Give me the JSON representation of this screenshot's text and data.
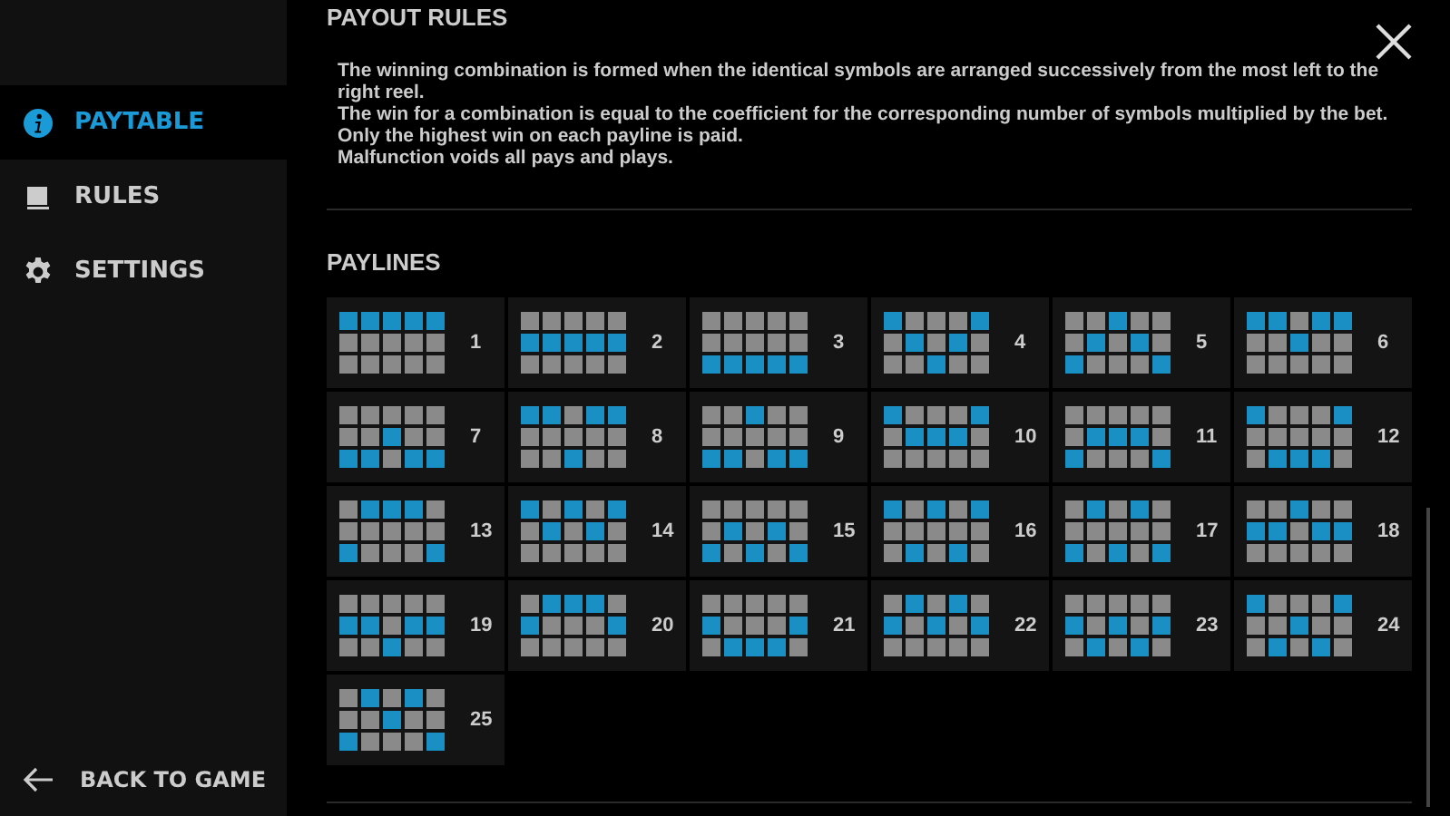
{
  "sidebar": {
    "items": [
      {
        "label": "PAYTABLE",
        "kind": "info",
        "selected": true
      },
      {
        "label": "RULES",
        "kind": "book",
        "selected": false
      },
      {
        "label": "SETTINGS",
        "kind": "gear",
        "selected": false
      }
    ],
    "back": {
      "label": "BACK TO GAME"
    }
  },
  "payout_rules": {
    "title": "PAYOUT RULES",
    "lines": [
      "The winning combination is formed when the identical symbols are arranged successively from the most left to the right reel.",
      "The win for a combination is equal to the coefficient for the corresponding number of symbols multiplied by the bet.",
      "Only the highest win on each payline is paid.",
      "Malfunction voids all pays and plays."
    ]
  },
  "paylines": {
    "title": "PAYLINES",
    "items": [
      {
        "number": "1",
        "cells": [
          [
            true,
            true,
            true,
            true,
            true
          ],
          [
            false,
            false,
            false,
            false,
            false
          ],
          [
            false,
            false,
            false,
            false,
            false
          ]
        ]
      },
      {
        "number": "2",
        "cells": [
          [
            false,
            false,
            false,
            false,
            false
          ],
          [
            true,
            true,
            true,
            true,
            true
          ],
          [
            false,
            false,
            false,
            false,
            false
          ]
        ]
      },
      {
        "number": "3",
        "cells": [
          [
            false,
            false,
            false,
            false,
            false
          ],
          [
            false,
            false,
            false,
            false,
            false
          ],
          [
            true,
            true,
            true,
            true,
            true
          ]
        ]
      },
      {
        "number": "4",
        "cells": [
          [
            true,
            false,
            false,
            false,
            true
          ],
          [
            false,
            true,
            false,
            true,
            false
          ],
          [
            false,
            false,
            true,
            false,
            false
          ]
        ]
      },
      {
        "number": "5",
        "cells": [
          [
            false,
            false,
            true,
            false,
            false
          ],
          [
            false,
            true,
            false,
            true,
            false
          ],
          [
            true,
            false,
            false,
            false,
            true
          ]
        ]
      },
      {
        "number": "6",
        "cells": [
          [
            true,
            true,
            false,
            true,
            true
          ],
          [
            false,
            false,
            true,
            false,
            false
          ],
          [
            false,
            false,
            false,
            false,
            false
          ]
        ]
      },
      {
        "number": "7",
        "cells": [
          [
            false,
            false,
            false,
            false,
            false
          ],
          [
            false,
            false,
            true,
            false,
            false
          ],
          [
            true,
            true,
            false,
            true,
            true
          ]
        ]
      },
      {
        "number": "8",
        "cells": [
          [
            true,
            true,
            false,
            true,
            true
          ],
          [
            false,
            false,
            false,
            false,
            false
          ],
          [
            false,
            false,
            true,
            false,
            false
          ]
        ]
      },
      {
        "number": "9",
        "cells": [
          [
            false,
            false,
            true,
            false,
            false
          ],
          [
            false,
            false,
            false,
            false,
            false
          ],
          [
            true,
            true,
            false,
            true,
            true
          ]
        ]
      },
      {
        "number": "10",
        "cells": [
          [
            true,
            false,
            false,
            false,
            true
          ],
          [
            false,
            true,
            true,
            true,
            false
          ],
          [
            false,
            false,
            false,
            false,
            false
          ]
        ]
      },
      {
        "number": "11",
        "cells": [
          [
            false,
            false,
            false,
            false,
            false
          ],
          [
            false,
            true,
            true,
            true,
            false
          ],
          [
            true,
            false,
            false,
            false,
            true
          ]
        ]
      },
      {
        "number": "12",
        "cells": [
          [
            true,
            false,
            false,
            false,
            true
          ],
          [
            false,
            false,
            false,
            false,
            false
          ],
          [
            false,
            true,
            true,
            true,
            false
          ]
        ]
      },
      {
        "number": "13",
        "cells": [
          [
            false,
            true,
            true,
            true,
            false
          ],
          [
            false,
            false,
            false,
            false,
            false
          ],
          [
            true,
            false,
            false,
            false,
            true
          ]
        ]
      },
      {
        "number": "14",
        "cells": [
          [
            true,
            false,
            true,
            false,
            true
          ],
          [
            false,
            true,
            false,
            true,
            false
          ],
          [
            false,
            false,
            false,
            false,
            false
          ]
        ]
      },
      {
        "number": "15",
        "cells": [
          [
            false,
            false,
            false,
            false,
            false
          ],
          [
            false,
            true,
            false,
            true,
            false
          ],
          [
            true,
            false,
            true,
            false,
            true
          ]
        ]
      },
      {
        "number": "16",
        "cells": [
          [
            true,
            false,
            true,
            false,
            true
          ],
          [
            false,
            false,
            false,
            false,
            false
          ],
          [
            false,
            true,
            false,
            true,
            false
          ]
        ]
      },
      {
        "number": "17",
        "cells": [
          [
            false,
            true,
            false,
            true,
            false
          ],
          [
            false,
            false,
            false,
            false,
            false
          ],
          [
            true,
            false,
            true,
            false,
            true
          ]
        ]
      },
      {
        "number": "18",
        "cells": [
          [
            false,
            false,
            true,
            false,
            false
          ],
          [
            true,
            true,
            false,
            true,
            true
          ],
          [
            false,
            false,
            false,
            false,
            false
          ]
        ]
      },
      {
        "number": "19",
        "cells": [
          [
            false,
            false,
            false,
            false,
            false
          ],
          [
            true,
            true,
            false,
            true,
            true
          ],
          [
            false,
            false,
            true,
            false,
            false
          ]
        ]
      },
      {
        "number": "20",
        "cells": [
          [
            false,
            true,
            true,
            true,
            false
          ],
          [
            true,
            false,
            false,
            false,
            true
          ],
          [
            false,
            false,
            false,
            false,
            false
          ]
        ]
      },
      {
        "number": "21",
        "cells": [
          [
            false,
            false,
            false,
            false,
            false
          ],
          [
            true,
            false,
            false,
            false,
            true
          ],
          [
            false,
            true,
            true,
            true,
            false
          ]
        ]
      },
      {
        "number": "22",
        "cells": [
          [
            false,
            true,
            false,
            true,
            false
          ],
          [
            true,
            false,
            true,
            false,
            true
          ],
          [
            false,
            false,
            false,
            false,
            false
          ]
        ]
      },
      {
        "number": "23",
        "cells": [
          [
            false,
            false,
            false,
            false,
            false
          ],
          [
            true,
            false,
            true,
            false,
            true
          ],
          [
            false,
            true,
            false,
            true,
            false
          ]
        ]
      },
      {
        "number": "24",
        "cells": [
          [
            true,
            false,
            false,
            false,
            true
          ],
          [
            false,
            false,
            true,
            false,
            false
          ],
          [
            false,
            true,
            false,
            true,
            false
          ]
        ]
      },
      {
        "number": "25",
        "cells": [
          [
            false,
            true,
            false,
            true,
            false
          ],
          [
            false,
            false,
            true,
            false,
            false
          ],
          [
            true,
            false,
            false,
            false,
            true
          ]
        ]
      }
    ]
  }
}
